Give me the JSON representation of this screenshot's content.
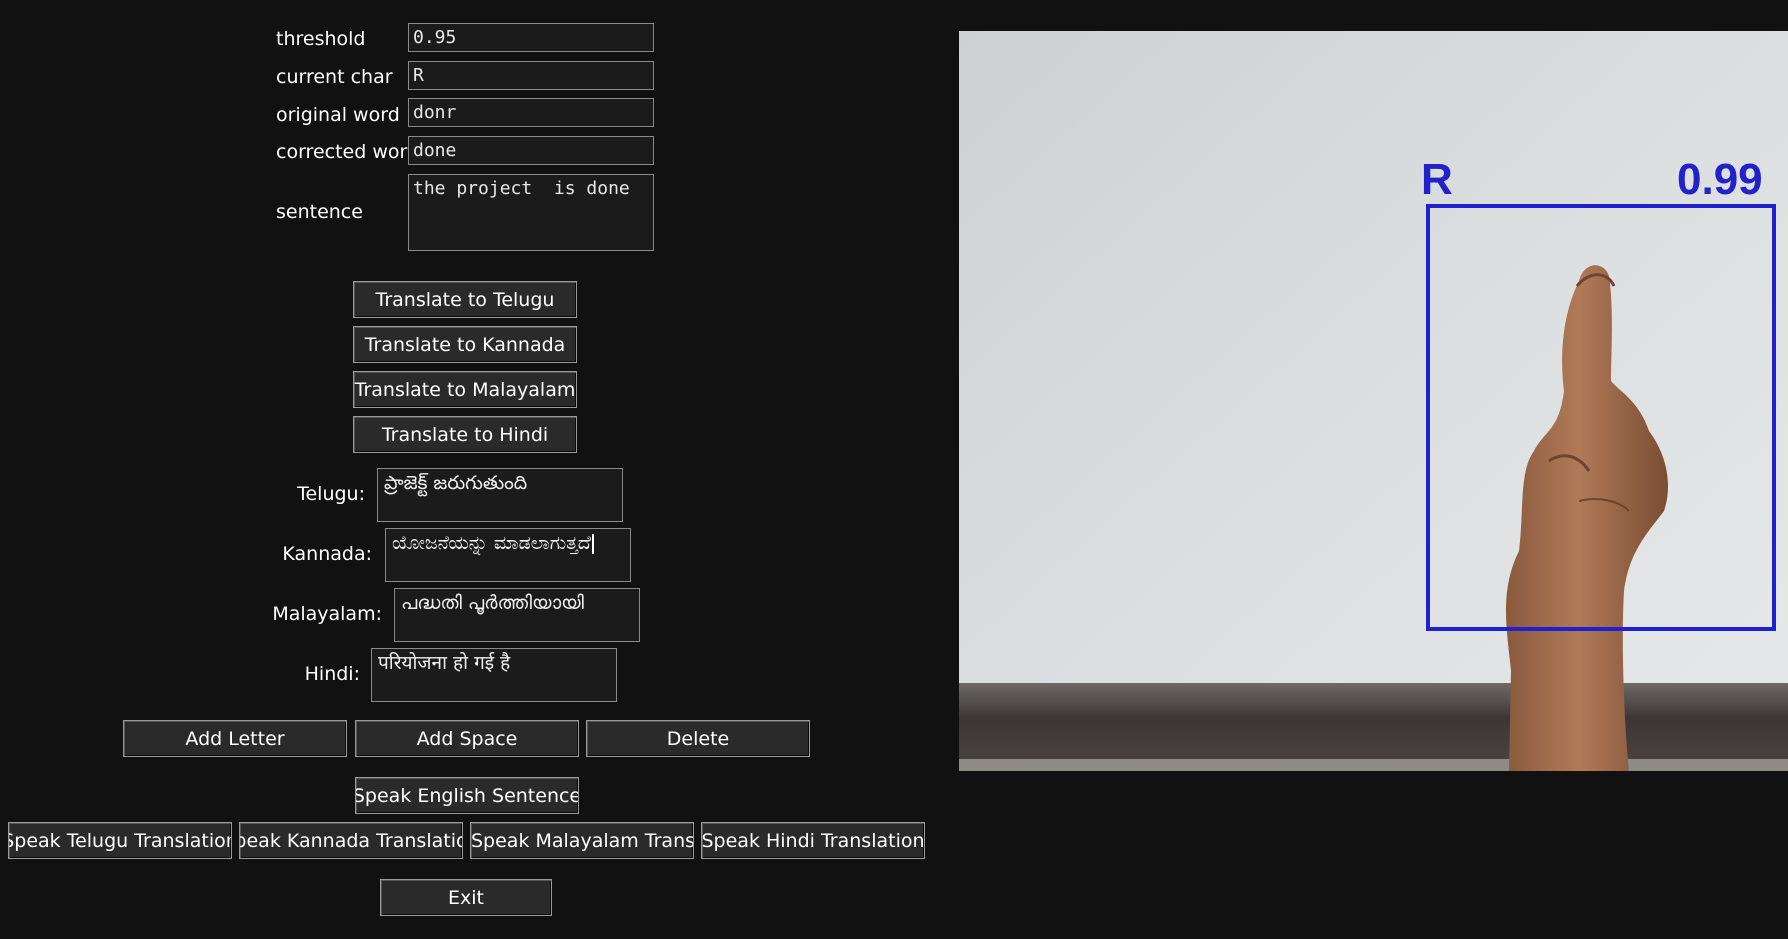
{
  "form": {
    "threshold": {
      "label": "threshold",
      "value": "0.95"
    },
    "current_char": {
      "label": "current char",
      "value": "R"
    },
    "original_word": {
      "label": "original word",
      "value": "donr"
    },
    "corrected_word": {
      "label": "corrected word",
      "value": "done"
    },
    "sentence": {
      "label": "sentence",
      "value": "the project  is done"
    }
  },
  "translate_buttons": {
    "telugu": "Translate to Telugu",
    "kannada": "Translate to Kannada",
    "malayalam": "Translate to Malayalam",
    "hindi": "Translate to Hindi"
  },
  "translations": {
    "telugu": {
      "label": "Telugu:",
      "value": "ప్రాజెక్ట్ జరుగుతుంది"
    },
    "kannada": {
      "label": "Kannada:",
      "value": "ಯೋಜನೆಯನ್ನು ಮಾಡಲಾಗುತ್ತದೆ"
    },
    "malayalam": {
      "label": "Malayalam:",
      "value": "പദ്ധതി പൂർത്തിയായി"
    },
    "hindi": {
      "label": "Hindi:",
      "value": "परियोजना हो गई है"
    }
  },
  "actions": {
    "add_letter": "Add Letter",
    "add_space": "Add Space",
    "delete": "Delete",
    "speak_english": "Speak English Sentence",
    "speak_telugu": "Speak Telugu Translation",
    "speak_kannada": "Speak Kannada Translation",
    "speak_malayalam": "Speak Malayalam Translation",
    "speak_hindi": "Speak Hindi Translation",
    "exit": "Exit"
  },
  "camera": {
    "detected_char": "R",
    "confidence": "0.99",
    "box_color": "#2020d0"
  }
}
